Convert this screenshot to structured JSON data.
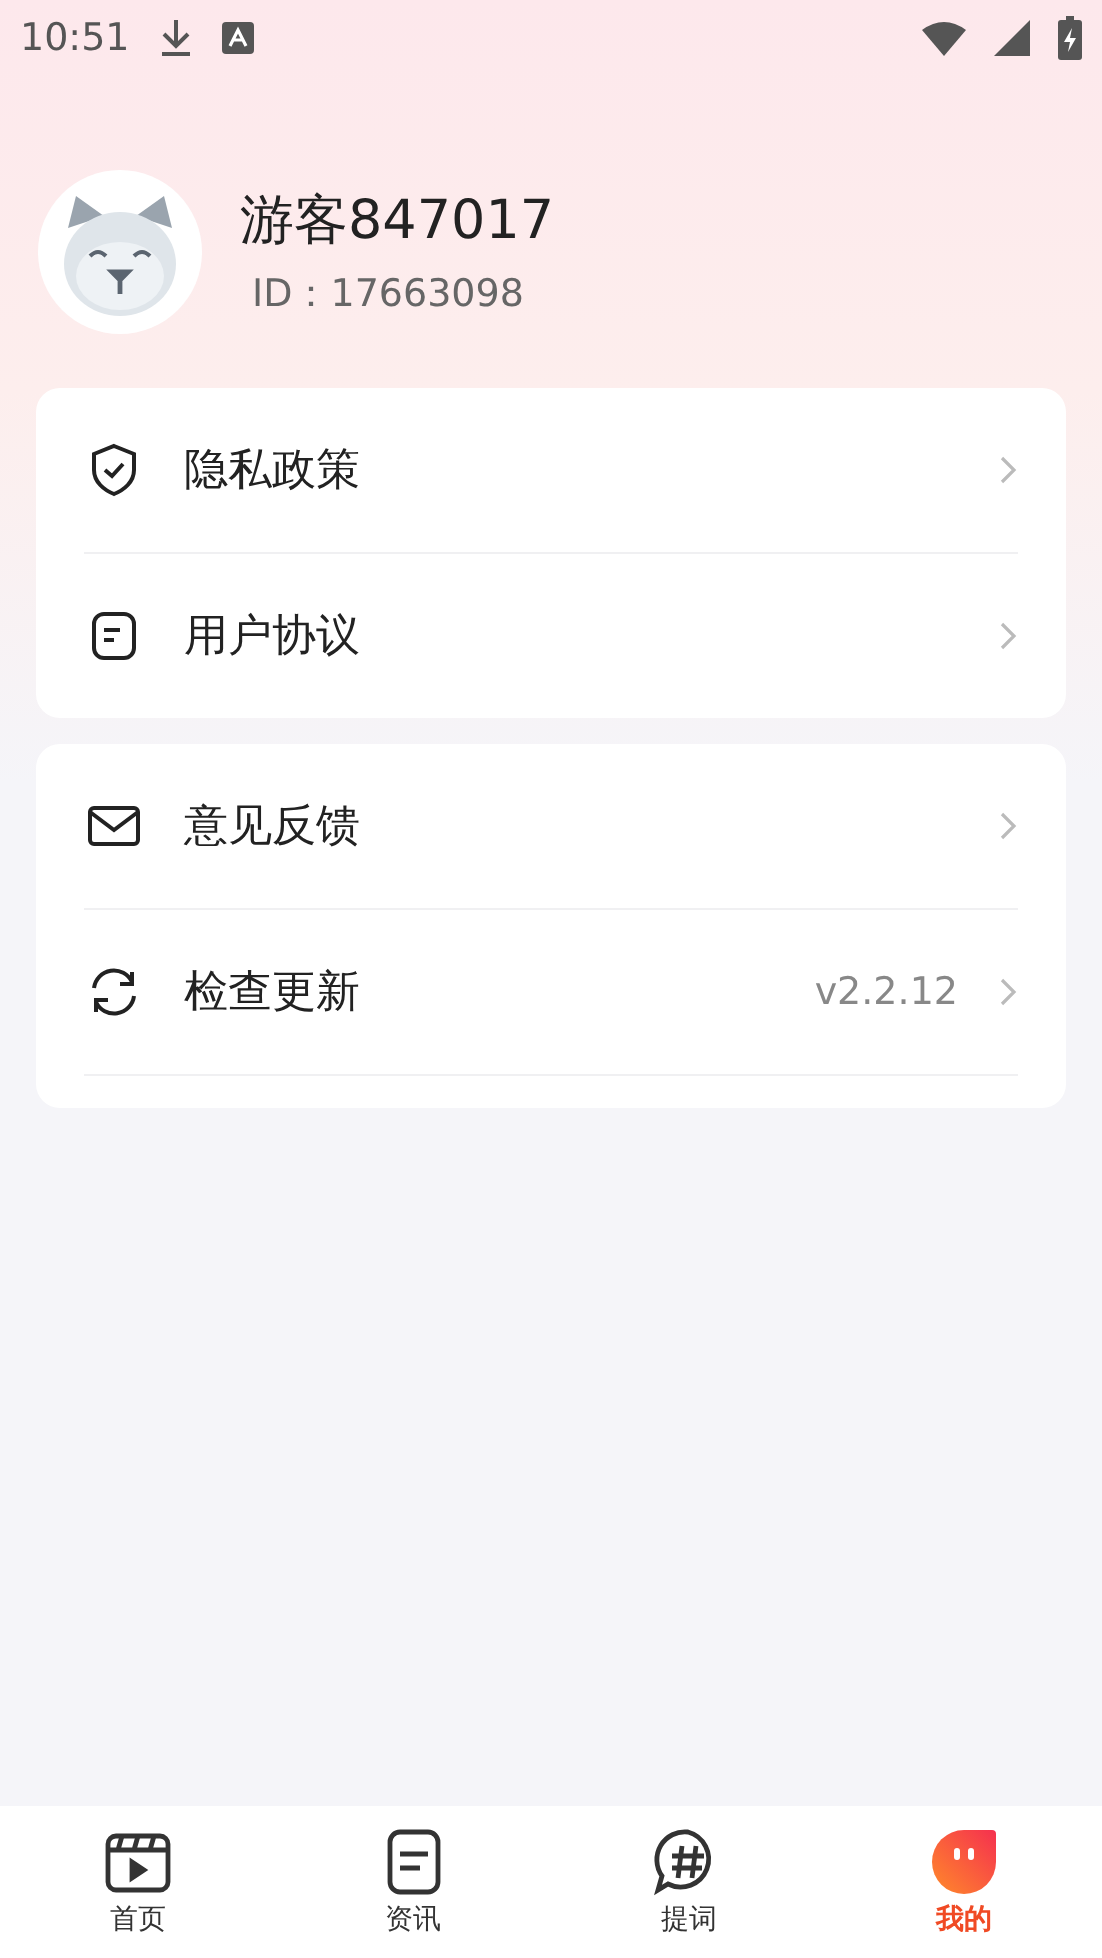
{
  "status_bar": {
    "time": "10:51"
  },
  "profile": {
    "name": "游客847017",
    "id": "ID：17663098"
  },
  "groups": [
    {
      "items": [
        {
          "label": "隐私政策"
        },
        {
          "label": "用户协议"
        }
      ]
    },
    {
      "items": [
        {
          "label": "意见反馈"
        },
        {
          "label": "检查更新",
          "value": "v2.2.12"
        }
      ],
      "trailing_divider": true
    }
  ],
  "tabs": [
    {
      "label": "首页",
      "selected": false
    },
    {
      "label": "资讯",
      "selected": false
    },
    {
      "label": "提词",
      "selected": false
    },
    {
      "label": "我的",
      "selected": true
    }
  ]
}
